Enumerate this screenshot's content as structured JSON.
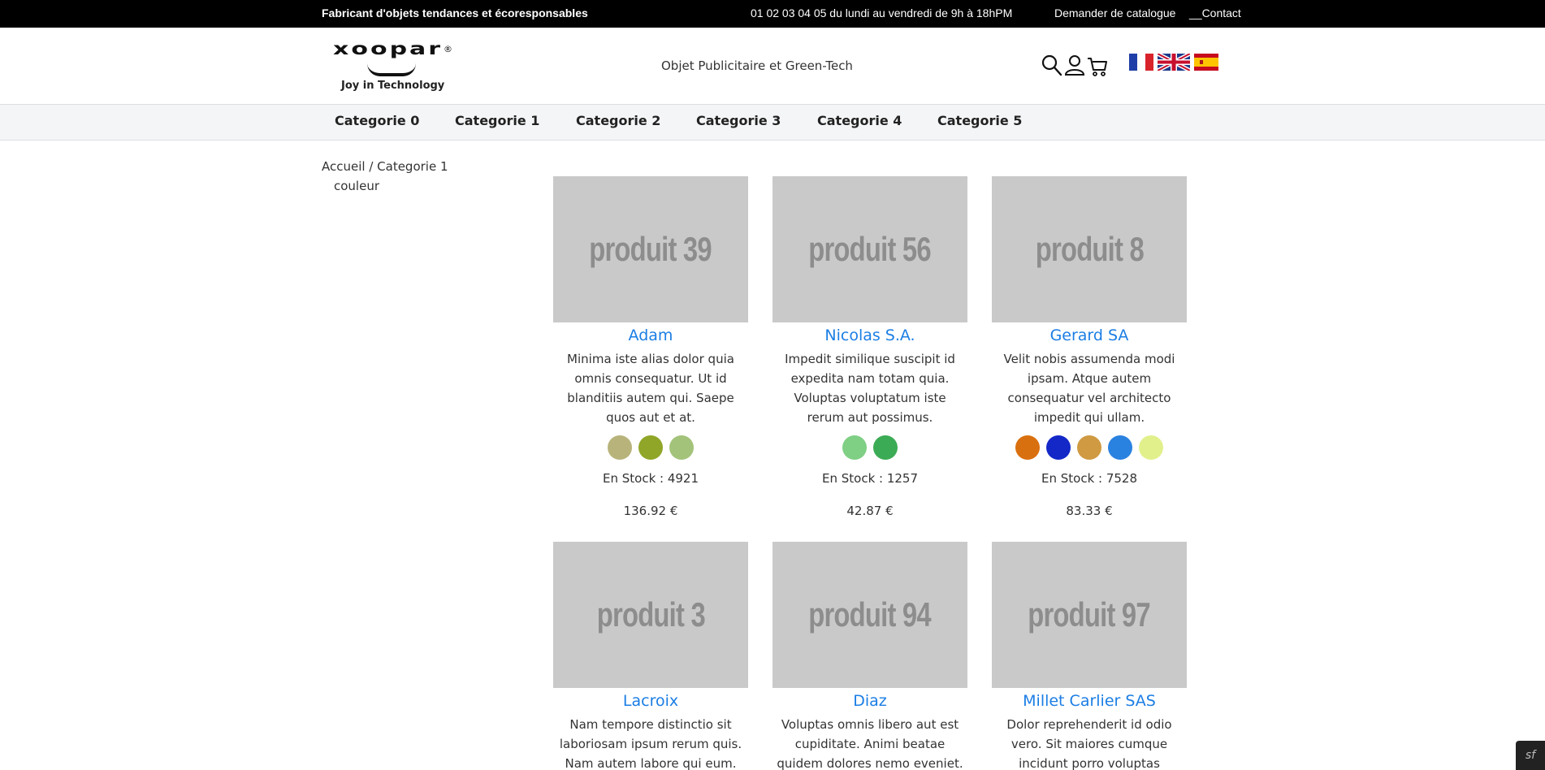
{
  "topbar": {
    "left": "Fabricant d'objets tendances et écoresponsables",
    "middle": "01 02 03 04 05 du lundi au vendredi de 9h à 18hPM",
    "catalogue": "Demander de catalogue",
    "contact": "__Contact"
  },
  "header": {
    "logo_word": "xoopar",
    "logo_reg": "®",
    "logo_tagline": "Joy in Technology",
    "tagline": "Objet Publicitaire et Green-Tech",
    "icons": [
      "search-icon",
      "user-icon",
      "cart-icon"
    ],
    "flags": [
      "flag-fr",
      "flag-uk",
      "flag-es"
    ]
  },
  "nav": {
    "items": [
      "Categorie 0",
      "Categorie 1",
      "Categorie 2",
      "Categorie 3",
      "Categorie 4",
      "Categorie 5"
    ]
  },
  "sidebar": {
    "breadcrumb": "Accueil / Categorie 1",
    "filter_label": "couleur"
  },
  "products": [
    {
      "image_text": "produit 39",
      "name": "Adam",
      "description": "Minima iste alias dolor quia omnis consequatur. Ut id blanditiis autem qui. Saepe quos aut et at.",
      "colors": [
        "#b8b37a",
        "#8fa628",
        "#a3c37a"
      ],
      "stock": "En Stock : 4921",
      "price": "136.92 €"
    },
    {
      "image_text": "produit 56",
      "name": "Nicolas S.A.",
      "description": "Impedit similique suscipit id expedita nam totam quia. Voluptas voluptatum iste rerum aut possimus.",
      "colors": [
        "#7fcf85",
        "#3cab55"
      ],
      "stock": "En Stock : 1257",
      "price": "42.87 €"
    },
    {
      "image_text": "produit 8",
      "name": "Gerard SA",
      "description": "Velit nobis assumenda modi ipsam. Atque autem consequatur vel architecto impedit qui ullam.",
      "colors": [
        "#d9700f",
        "#1428c8",
        "#cf9a42",
        "#2a82e0",
        "#e2f08c"
      ],
      "stock": "En Stock : 7528",
      "price": "83.33 €"
    },
    {
      "image_text": "produit 3",
      "name": "Lacroix",
      "description": "Nam tempore distinctio sit laboriosam ipsum rerum quis. Nam autem labore qui eum.",
      "colors": [],
      "stock": "",
      "price": ""
    },
    {
      "image_text": "produit 94",
      "name": "Diaz",
      "description": "Voluptas omnis libero aut est cupiditate. Animi beatae quidem dolores nemo eveniet.",
      "colors": [],
      "stock": "",
      "price": ""
    },
    {
      "image_text": "produit 97",
      "name": "Millet Carlier SAS",
      "description": "Dolor reprehenderit id odio vero. Sit maiores cumque incidunt porro voluptas temporibus.",
      "colors": [],
      "stock": "",
      "price": ""
    }
  ],
  "debug_toolbar": "sf"
}
